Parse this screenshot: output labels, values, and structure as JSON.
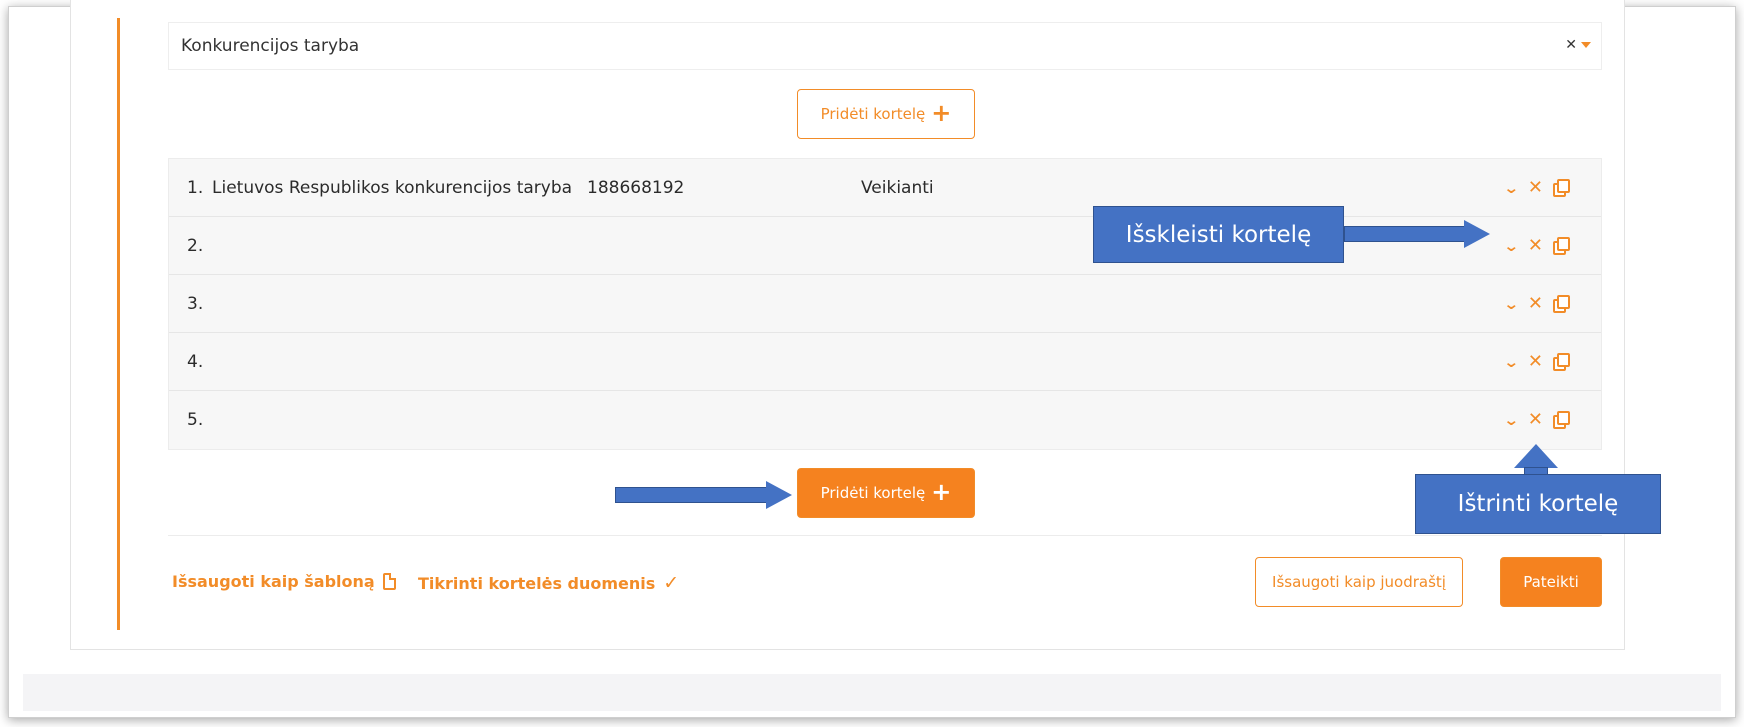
{
  "select": {
    "value": "Konkurencijos taryba",
    "clear": "✕"
  },
  "add_card_label": "Pridėti kortelę",
  "cards": [
    {
      "index": "1.",
      "title": "Lietuvos Respublikos konkurencijos taryba",
      "code": "188668192",
      "status": "Veikianti"
    },
    {
      "index": "2.",
      "title": "",
      "code": "",
      "status": ""
    },
    {
      "index": "3.",
      "title": "",
      "code": "",
      "status": ""
    },
    {
      "index": "4.",
      "title": "",
      "code": "",
      "status": ""
    },
    {
      "index": "5.",
      "title": "",
      "code": "",
      "status": ""
    }
  ],
  "footer": {
    "save_template": "Išsaugoti kaip šabloną",
    "check_data": "Tikrinti kortelės duomenis",
    "save_draft": "Išsaugoti kaip juodraštį",
    "submit": "Pateikti"
  },
  "annotations": {
    "expand": "Išskleisti kortelę",
    "delete": "Ištrinti kortelę"
  },
  "colors": {
    "accent": "#f28c28",
    "callout": "#4472c4"
  }
}
